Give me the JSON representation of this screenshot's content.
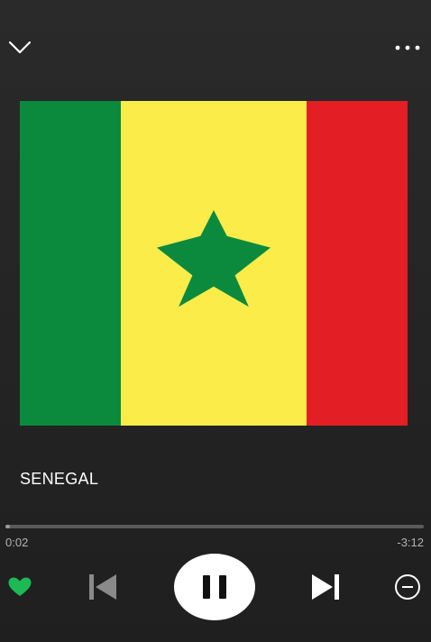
{
  "header": {
    "collapse_icon": "chevron-down-icon",
    "menu_icon": "more-horizontal-icon"
  },
  "artwork": {
    "subject": "flag of Senegal",
    "colors": {
      "green": "#0b8a3d",
      "yellow": "#fbec4a",
      "red": "#e31e24",
      "star": "#0b8a3d"
    }
  },
  "track": {
    "title": "SENEGAL"
  },
  "playback": {
    "elapsed": "0:02",
    "remaining": "-3:12",
    "progress_fraction": 0.01,
    "state": "playing"
  },
  "controls": {
    "like_icon": "heart-filled-icon",
    "like_color": "#1db954",
    "previous_icon": "skip-previous-icon",
    "pause_icon": "pause-icon",
    "next_icon": "skip-next-icon",
    "hide_icon": "minus-circle-icon"
  }
}
